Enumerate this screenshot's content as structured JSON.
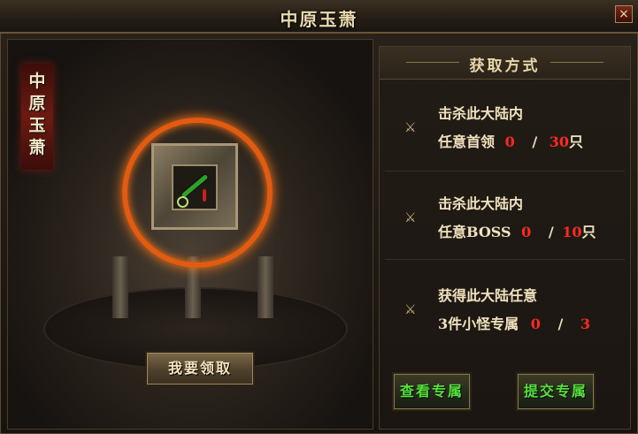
{
  "window": {
    "title": "中原玉萧",
    "close_label": "×"
  },
  "left_panel": {
    "banner_text": "中\n原\n玉\n萧",
    "claim_button_label": "我要领取"
  },
  "right_panel": {
    "header": "获取方式",
    "entries": [
      {
        "line1": "击杀此大陆内",
        "line2_prefix": "任意首领",
        "current": "0",
        "sep": "/",
        "target": "30",
        "unit": "只"
      },
      {
        "line1": "击杀此大陆内",
        "line2_prefix": "任意BOSS",
        "current": "0",
        "sep": "/",
        "target": "10",
        "unit": "只"
      },
      {
        "line1": "获得此大陆任意",
        "line2_prefix": "3件小怪专属",
        "current": "0",
        "sep": "/",
        "target": "3",
        "unit": ""
      }
    ],
    "view_button_label": "查看专属",
    "submit_button_label": "提交专属"
  },
  "colors": {
    "accent_red": "#ff2a1f",
    "button_green": "#55e13c",
    "ring_orange": "#e35b10"
  },
  "icons": {
    "entry_icon": "crossed-swords-icon",
    "close_icon": "close-icon"
  }
}
